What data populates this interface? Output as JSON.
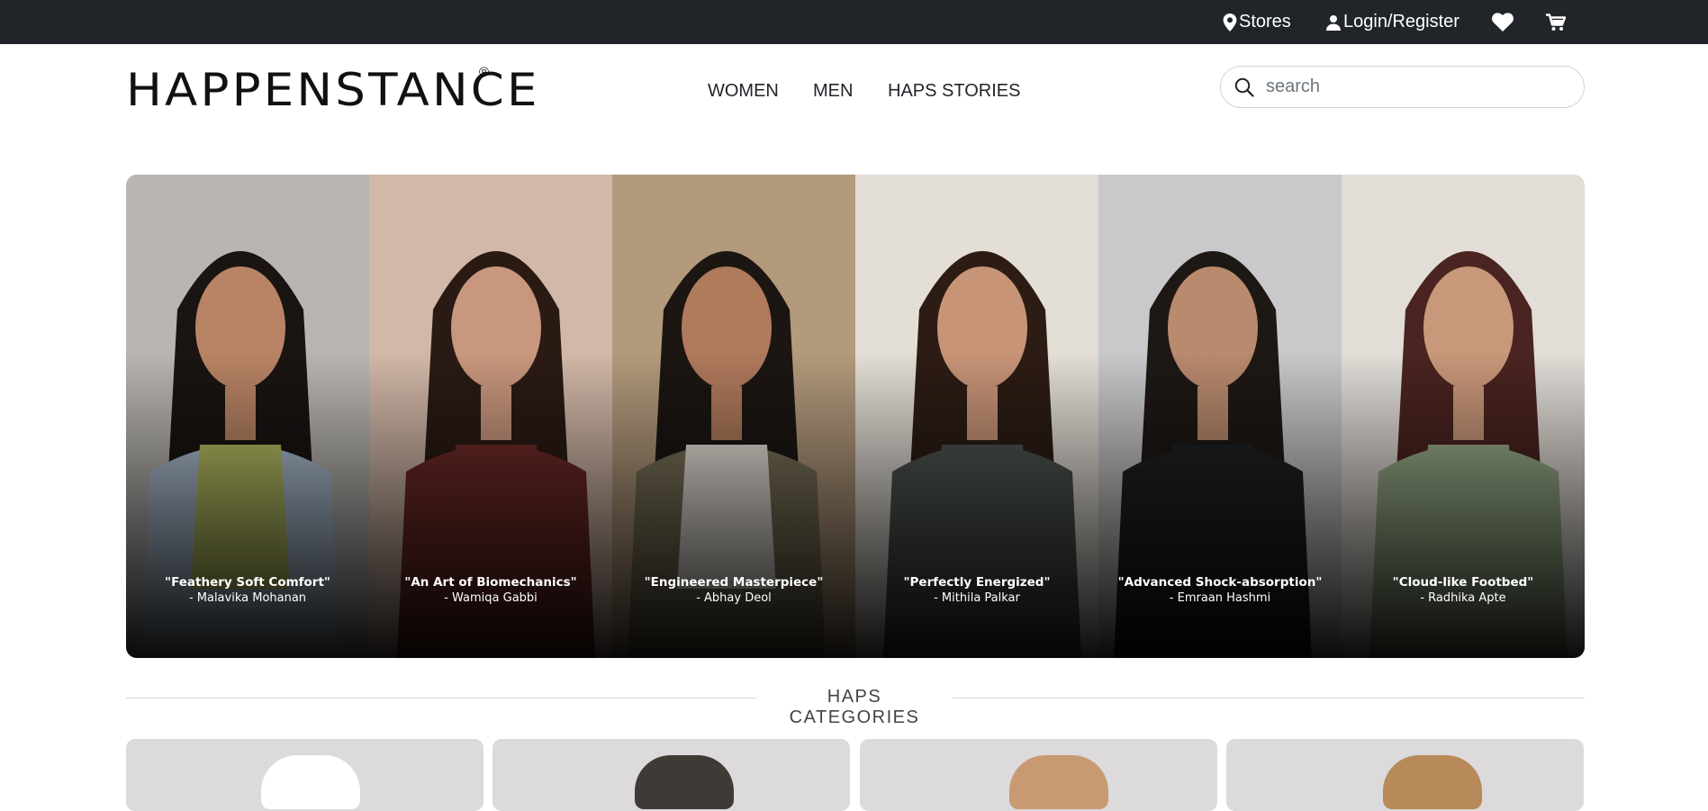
{
  "topbar": {
    "stores_label": "Stores",
    "login_label": "Login/Register",
    "icons": [
      "location-pin-icon",
      "user-icon",
      "heart-icon",
      "cart-icon"
    ]
  },
  "header": {
    "logo_text": "HAPPENSTANCE",
    "logo_mark": "®",
    "nav": [
      {
        "label": "WOMEN"
      },
      {
        "label": "MEN"
      },
      {
        "label": "HAPS STORIES"
      }
    ],
    "search": {
      "placeholder": "search",
      "value": ""
    }
  },
  "hero": {
    "panels": [
      {
        "quote": "\"Feathery Soft Comfort\"",
        "author": "- Malavika Mohanan",
        "bg": "#b9b6b2",
        "skin": "#b98465",
        "hair": "#1a1412",
        "top": "#b8bf63",
        "jacket": "#aebfd2"
      },
      {
        "quote": "\"An Art of Biomechanics\"",
        "author": "- Wamiqa Gabbi",
        "bg": "#d2b8a8",
        "skin": "#c9977e",
        "hair": "#2a1a14",
        "top": "#6e2a26",
        "jacket": "#6e2a26"
      },
      {
        "quote": "\"Engineered Masterpiece\"",
        "author": "- Abhay Deol",
        "bg": "#b39a7c",
        "skin": "#b07a5c",
        "hair": "#1c1612",
        "top": "#e9e4dc",
        "jacket": "#7a7158"
      },
      {
        "quote": "\"Perfectly Energized\"",
        "author": "- Mithila Palkar",
        "bg": "#e3ded6",
        "skin": "#c89478",
        "hair": "#2c1c14",
        "top": "#4d5450",
        "jacket": "#4d5450"
      },
      {
        "quote": "\"Advanced Shock-absorption\"",
        "author": "- Emraan Hashmi",
        "bg": "#c9c9cb",
        "skin": "#b98a6e",
        "hair": "#1e1815",
        "top": "#1e2124",
        "jacket": "#1e2124"
      },
      {
        "quote": "\"Cloud-like Footbed\"",
        "author": "- Radhika Apte",
        "bg": "#e2ddd7",
        "skin": "#c9977a",
        "hair": "#4a2420",
        "top": "#9aae8a",
        "jacket": "#9aae8a"
      }
    ]
  },
  "categories": {
    "title": "HAPS CATEGORIES",
    "cards": [
      {
        "name": "category-card-1",
        "tint": "#ffffff"
      },
      {
        "name": "category-card-2",
        "tint": "#3f3a36"
      },
      {
        "name": "category-card-3",
        "tint": "#c89a72"
      },
      {
        "name": "category-card-4",
        "tint": "#b88a5a"
      }
    ]
  }
}
